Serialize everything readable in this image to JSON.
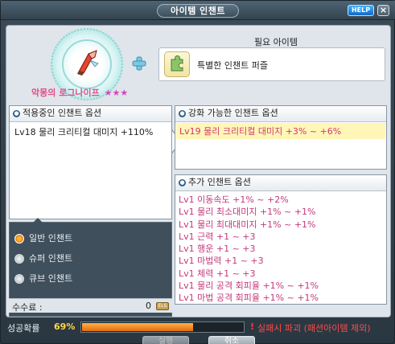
{
  "window": {
    "title": "아이템 인챈트",
    "help_label": "HELP",
    "close_label": "×"
  },
  "target_item": {
    "name": "악몽의 로그나이프",
    "stars": "★★★"
  },
  "required": {
    "label": "필요 아이템",
    "item_name": "특별한 인챈트 퍼즐"
  },
  "current_options": {
    "header": "적용중인 인챈트 옵션",
    "lines": [
      "Lv18 물리 크리티컬 대미지 +110%"
    ]
  },
  "upgradable_options": {
    "header": "강화 가능한 인챈트 옵션",
    "lines": [
      "Lv19 물리 크리티컬 대미지 +3% ~ +6%"
    ]
  },
  "additional_options": {
    "header": "추가 인챈트 옵션",
    "lines": [
      "Lv1 이동속도 +1% ~ +2%",
      "Lv1 물리 최소대미지 +1% ~ +1%",
      "Lv1 물리 최대대미지 +1% ~ +1%",
      "Lv1 근력 +1 ~ +3",
      "Lv1 행운 +1 ~ +3",
      "Lv1 마법력 +1 ~ +3",
      "Lv1 체력 +1 ~ +3",
      "Lv1 물리 공격 회피율 +1% ~ +1%",
      "Lv1 마법 공격 회피율 +1% ~ +1%"
    ]
  },
  "enchant_types": {
    "options": [
      {
        "label": "일반 인챈트",
        "selected": true
      },
      {
        "label": "슈퍼 인챈트",
        "selected": false
      },
      {
        "label": "큐브 인챈트",
        "selected": false
      }
    ]
  },
  "fee": {
    "label": "수수료 :",
    "value": "0",
    "currency_icon_label": "ELS"
  },
  "success": {
    "label": "성공확률",
    "value": "69",
    "unit": "%",
    "progress_fraction": 0.69,
    "warning_icon": "!",
    "warning_text": "실패시 파괴 (패션아이템 제외)"
  },
  "buttons": {
    "ok_label": "실행",
    "cancel_label": "취소"
  },
  "colors": {
    "accent_pink": "#c4387b",
    "upgrade_highlight": "#fff6b8",
    "warning_red": "#ff4a4a",
    "rate_yellow": "#ffd84a"
  }
}
